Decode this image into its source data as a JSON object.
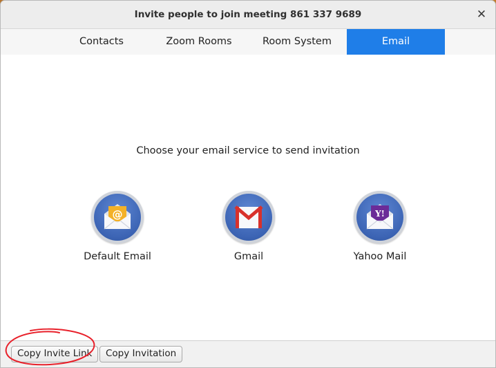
{
  "window": {
    "title": "Invite people to join meeting 861 337 9689",
    "close_glyph": "✕"
  },
  "tabs": [
    {
      "label": "Contacts",
      "active": false
    },
    {
      "label": "Zoom Rooms",
      "active": false
    },
    {
      "label": "Room System",
      "active": false
    },
    {
      "label": "Email",
      "active": true
    }
  ],
  "main": {
    "prompt": "Choose your email service to send invitation",
    "services": [
      {
        "label": "Default Email",
        "icon": "default-email-envelope-icon"
      },
      {
        "label": "Gmail",
        "icon": "gmail-envelope-icon"
      },
      {
        "label": "Yahoo Mail",
        "icon": "yahoo-mail-envelope-icon"
      }
    ]
  },
  "footer": {
    "copy_link_label": "Copy Invite Link",
    "copy_invitation_label": "Copy Invitation"
  },
  "colors": {
    "tab_active": "#1f7ee8",
    "annotation_red": "#e8202a"
  }
}
